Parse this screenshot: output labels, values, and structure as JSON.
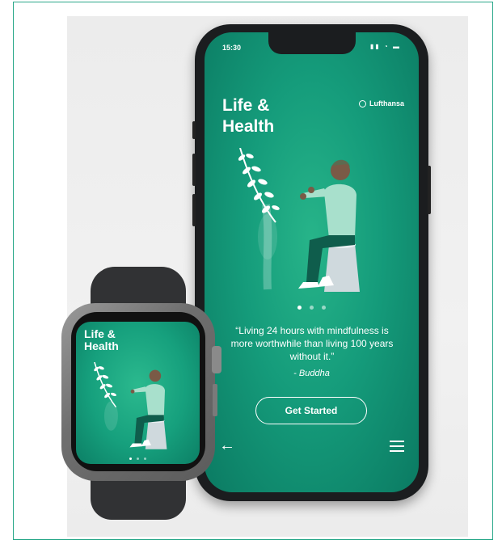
{
  "phone": {
    "status_time": "15:30",
    "status_icons": [
      "signal-icon",
      "wifi-icon",
      "battery-icon"
    ],
    "title_line1": "Life &",
    "title_line2": "Health",
    "brand_name": "Lufthansa",
    "brand_icon": "lufthansa-crane-icon",
    "carousel": {
      "count": 3,
      "active_index": 0
    },
    "quote_text": "“Living 24 hours with mindfulness is more worthwhile than living 100 years without it.”",
    "quote_author": "- Buddha",
    "cta_label": "Get Started",
    "back_icon": "arrow-left-icon",
    "menu_icon": "hamburger-menu-icon"
  },
  "watch": {
    "title_line1": "Life &",
    "title_line2": "Health",
    "carousel": {
      "count": 3,
      "active_index": 0
    }
  },
  "colors": {
    "accent_green": "#159c7b",
    "deep_green": "#0b7a62",
    "figure_shirt": "#a8e0cc",
    "figure_pants": "#0f5d4c",
    "frame_border": "#2aa88a"
  }
}
